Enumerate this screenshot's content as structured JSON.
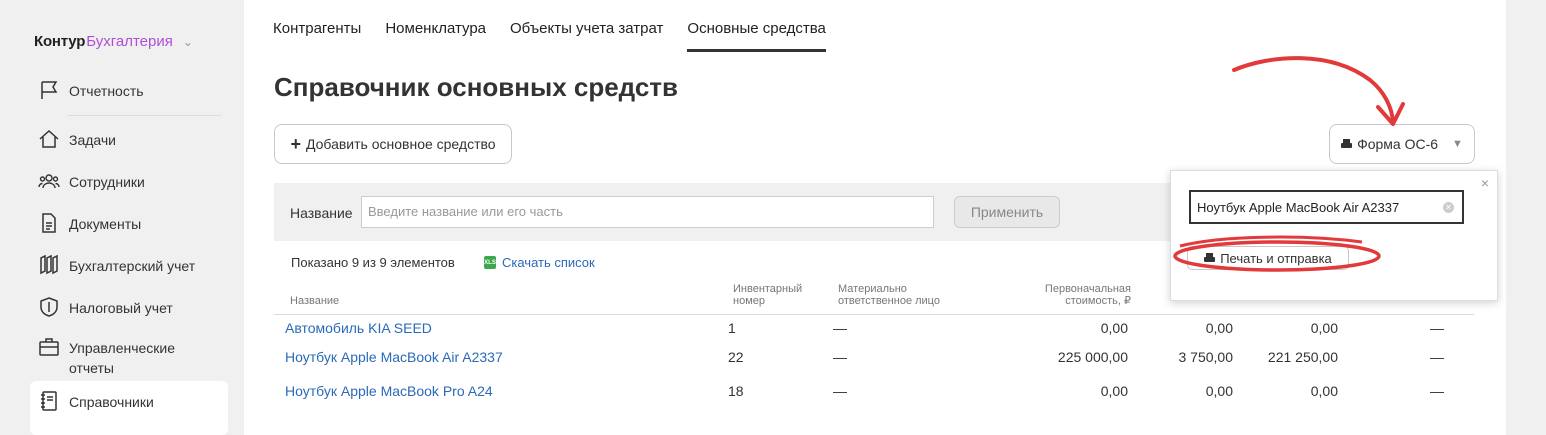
{
  "app": {
    "brand_part1": "Контур",
    "brand_part2": "Бухгалтерия"
  },
  "sidebar": {
    "items": [
      {
        "label": "Отчетность"
      },
      {
        "label": "Задачи"
      },
      {
        "label": "Сотрудники"
      },
      {
        "label": "Документы"
      },
      {
        "label": "Бухгалтерский учет"
      },
      {
        "label": "Налоговый учет"
      },
      {
        "label": "Управленческие",
        "label2": "отчеты"
      },
      {
        "label": "Справочники"
      }
    ]
  },
  "tabs": [
    {
      "label": "Контрагенты"
    },
    {
      "label": "Номенклатура"
    },
    {
      "label": "Объекты учета затрат"
    },
    {
      "label": "Основные средства"
    }
  ],
  "page": {
    "title": "Справочник основных средств",
    "add_button": "Добавить основное средство",
    "form_button": "Форма ОС-6"
  },
  "filter": {
    "label": "Название",
    "placeholder": "Введите название или его часть",
    "apply": "Применить"
  },
  "summary": {
    "shown": "Показано 9 из 9 элементов",
    "xls": "XLS",
    "download": "Скачать список"
  },
  "table": {
    "headers": {
      "name": "Название",
      "inv1": "Инвентарный",
      "inv2": "номер",
      "mol1": "Материально",
      "mol2": "ответственное лицо",
      "cost1": "Первоначальная",
      "cost2": "стоимость, ₽"
    },
    "rows": [
      {
        "name": "Автомобиль KIA SEED",
        "inv": "1",
        "mol": "—",
        "cost": "0,00",
        "c2": "0,00",
        "c3": "0,00",
        "c4": "—"
      },
      {
        "name": "Ноутбук Apple MacBook Air A2337",
        "inv": "22",
        "mol": "—",
        "cost": "225 000,00",
        "c2": "3 750,00",
        "c3": "221 250,00",
        "c4": "—"
      },
      {
        "name": "Ноутбук Apple MacBook Pro A24",
        "inv": "18",
        "mol": "—",
        "cost": "0,00",
        "c2": "0,00",
        "c3": "0,00",
        "c4": "—"
      }
    ]
  },
  "popup": {
    "close": "×",
    "input_value": "Ноутбук Apple MacBook Air A2337",
    "print_button": "Печать и отправка"
  },
  "annotation": {
    "color": "#e23a3a"
  }
}
